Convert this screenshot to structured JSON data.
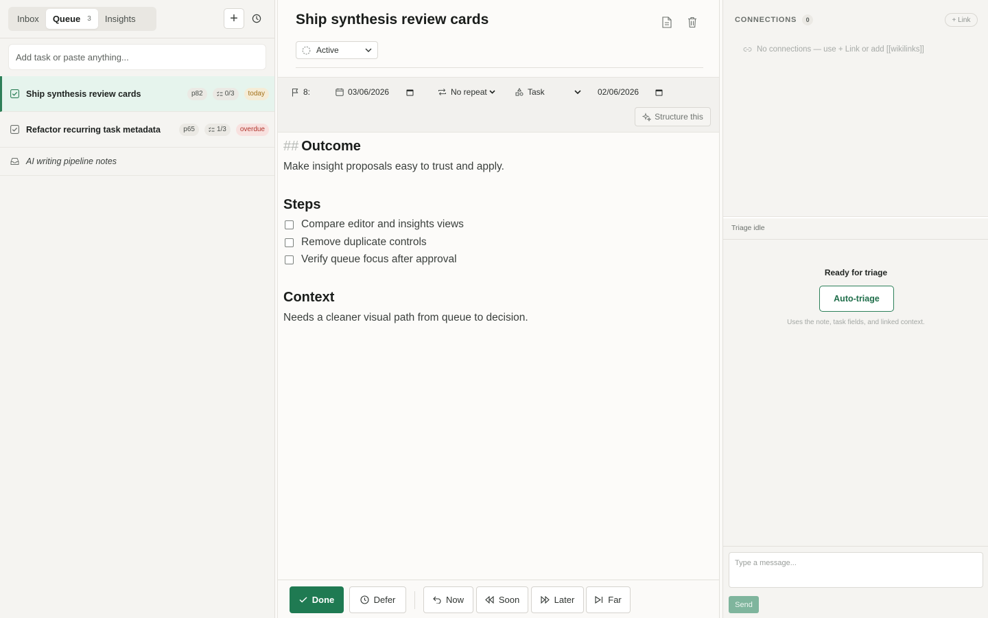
{
  "sidebar": {
    "tabs": [
      {
        "label": "Inbox",
        "count": ""
      },
      {
        "label": "Queue",
        "count": "3"
      },
      {
        "label": "Insights",
        "count": ""
      }
    ],
    "add_label": "+",
    "quick_add_placeholder": "Add task or paste anything...",
    "tasks": [
      {
        "title": "Ship synthesis review cards",
        "priority": "p82",
        "subtasks": "0/3",
        "due": "today"
      },
      {
        "title": "Refactor recurring task metadata",
        "priority": "p65",
        "subtasks": "1/3",
        "due": "overdue"
      }
    ],
    "notes": [
      {
        "title": "AI writing pipeline notes"
      }
    ]
  },
  "editor": {
    "title": "Ship synthesis review cards",
    "status": "Active",
    "fields": {
      "priority": "8:",
      "due_date": "03/06/2026",
      "repeat": "No repeat",
      "type": "Task",
      "start_date": "02/06/2026"
    },
    "structure_label": "Structure this",
    "content": {
      "outcome_hashes": "##",
      "outcome_heading": "Outcome",
      "outcome_text": "Make insight proposals easy to trust and apply.",
      "steps_heading": "Steps",
      "steps": [
        "Compare editor and insights views",
        "Remove duplicate controls",
        "Verify queue focus after approval"
      ],
      "context_heading": "Context",
      "context_text": "Needs a cleaner visual path from queue to decision."
    },
    "actions": {
      "done": "Done",
      "defer": "Defer",
      "now": "Now",
      "soon": "Soon",
      "later": "Later",
      "far": "Far"
    }
  },
  "connections": {
    "header": "CONNECTIONS",
    "count": "0",
    "link_label": "+ Link",
    "empty_text": "No connections — use + Link or add [[wikilinks]]"
  },
  "triage": {
    "status": "Triage idle",
    "ready_title": "Ready for triage",
    "button_label": "Auto-triage",
    "subtitle": "Uses the note, task fields, and linked context."
  },
  "chat": {
    "placeholder": "Type a message...",
    "send_label": "Send"
  },
  "colors": {
    "accent": "#1f7a52",
    "selected_row": "#e6f4ed",
    "today": "#a2711a",
    "overdue": "#b0342c"
  }
}
